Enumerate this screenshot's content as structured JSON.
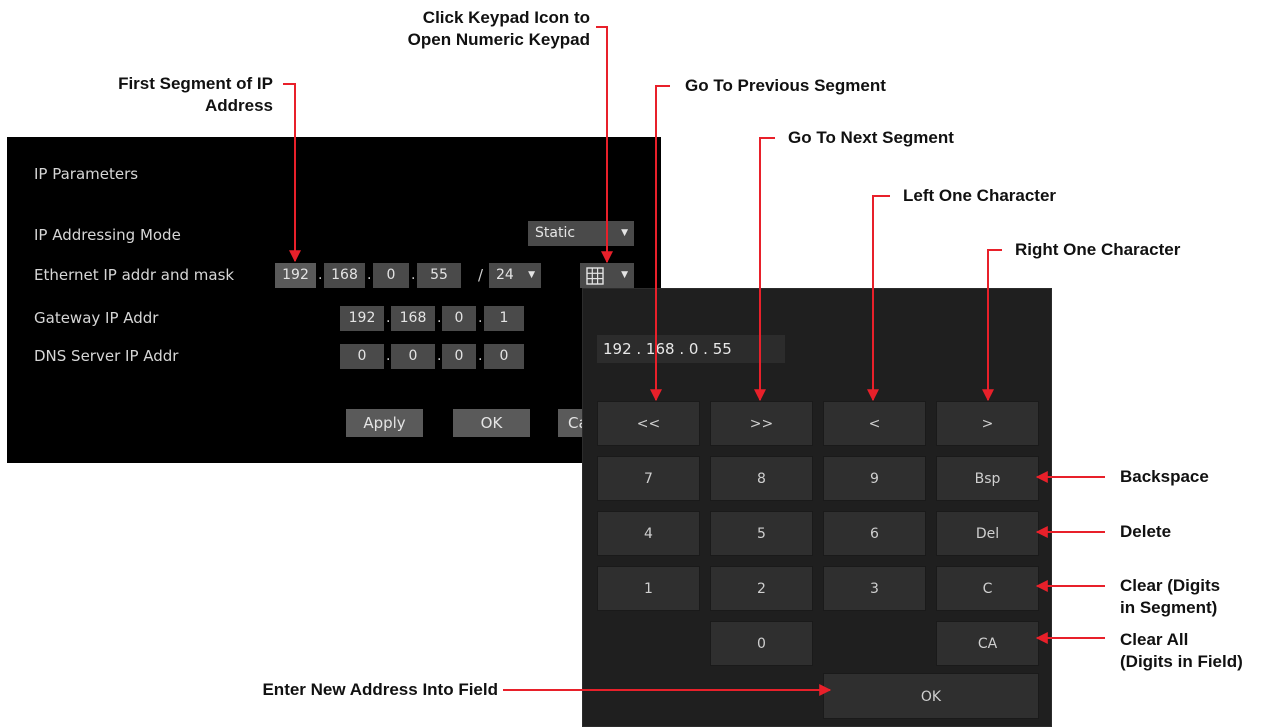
{
  "dialog": {
    "title": "IP Parameters",
    "mode_label": "IP Addressing Mode",
    "mode_value": "Static",
    "eth_label": "Ethernet IP addr and mask",
    "eth_ip": [
      "192",
      "168",
      "0",
      "55"
    ],
    "mask_sep": "/",
    "mask_value": "24",
    "gateway_label": "Gateway IP Addr",
    "gateway_ip": [
      "192",
      "168",
      "0",
      "1"
    ],
    "dns_label": "DNS Server IP Addr",
    "dns_ip": [
      "0",
      "0",
      "0",
      "0"
    ],
    "dot": ".",
    "apply_label": "Apply",
    "ok_label": "OK",
    "cancel_label_partial": "Ca",
    "keypad_icon": "keypad-grid-icon"
  },
  "keypad": {
    "field_value": "192 . 168 .  0  . 55",
    "keys": {
      "prev_segment": "<<",
      "next_segment": ">>",
      "left": "<",
      "right": ">",
      "k7": "7",
      "k8": "8",
      "k9": "9",
      "bsp": "Bsp",
      "k4": "4",
      "k5": "5",
      "k6": "6",
      "del": "Del",
      "k1": "1",
      "k2": "2",
      "k3": "3",
      "clear": "C",
      "k0": "0",
      "clear_all": "CA",
      "ok": "OK"
    }
  },
  "annotations": {
    "click_keypad": [
      "Click Keypad Icon to",
      "Open Numeric Keypad"
    ],
    "first_segment": [
      "First Segment of IP",
      "Address"
    ],
    "prev_segment": "Go To Previous Segment",
    "next_segment": "Go To Next Segment",
    "left_char": "Left One Character",
    "right_char": "Right One Character",
    "backspace": "Backspace",
    "delete": "Delete",
    "clear": [
      "Clear (Digits",
      "in Segment)"
    ],
    "clear_all": [
      "Clear All",
      "(Digits in Field)"
    ],
    "enter_new": "Enter New Address Into Field"
  },
  "colors": {
    "arrow": "#e8202a",
    "panel_bg": "#000000",
    "keypad_bg": "#1f1f1f"
  }
}
